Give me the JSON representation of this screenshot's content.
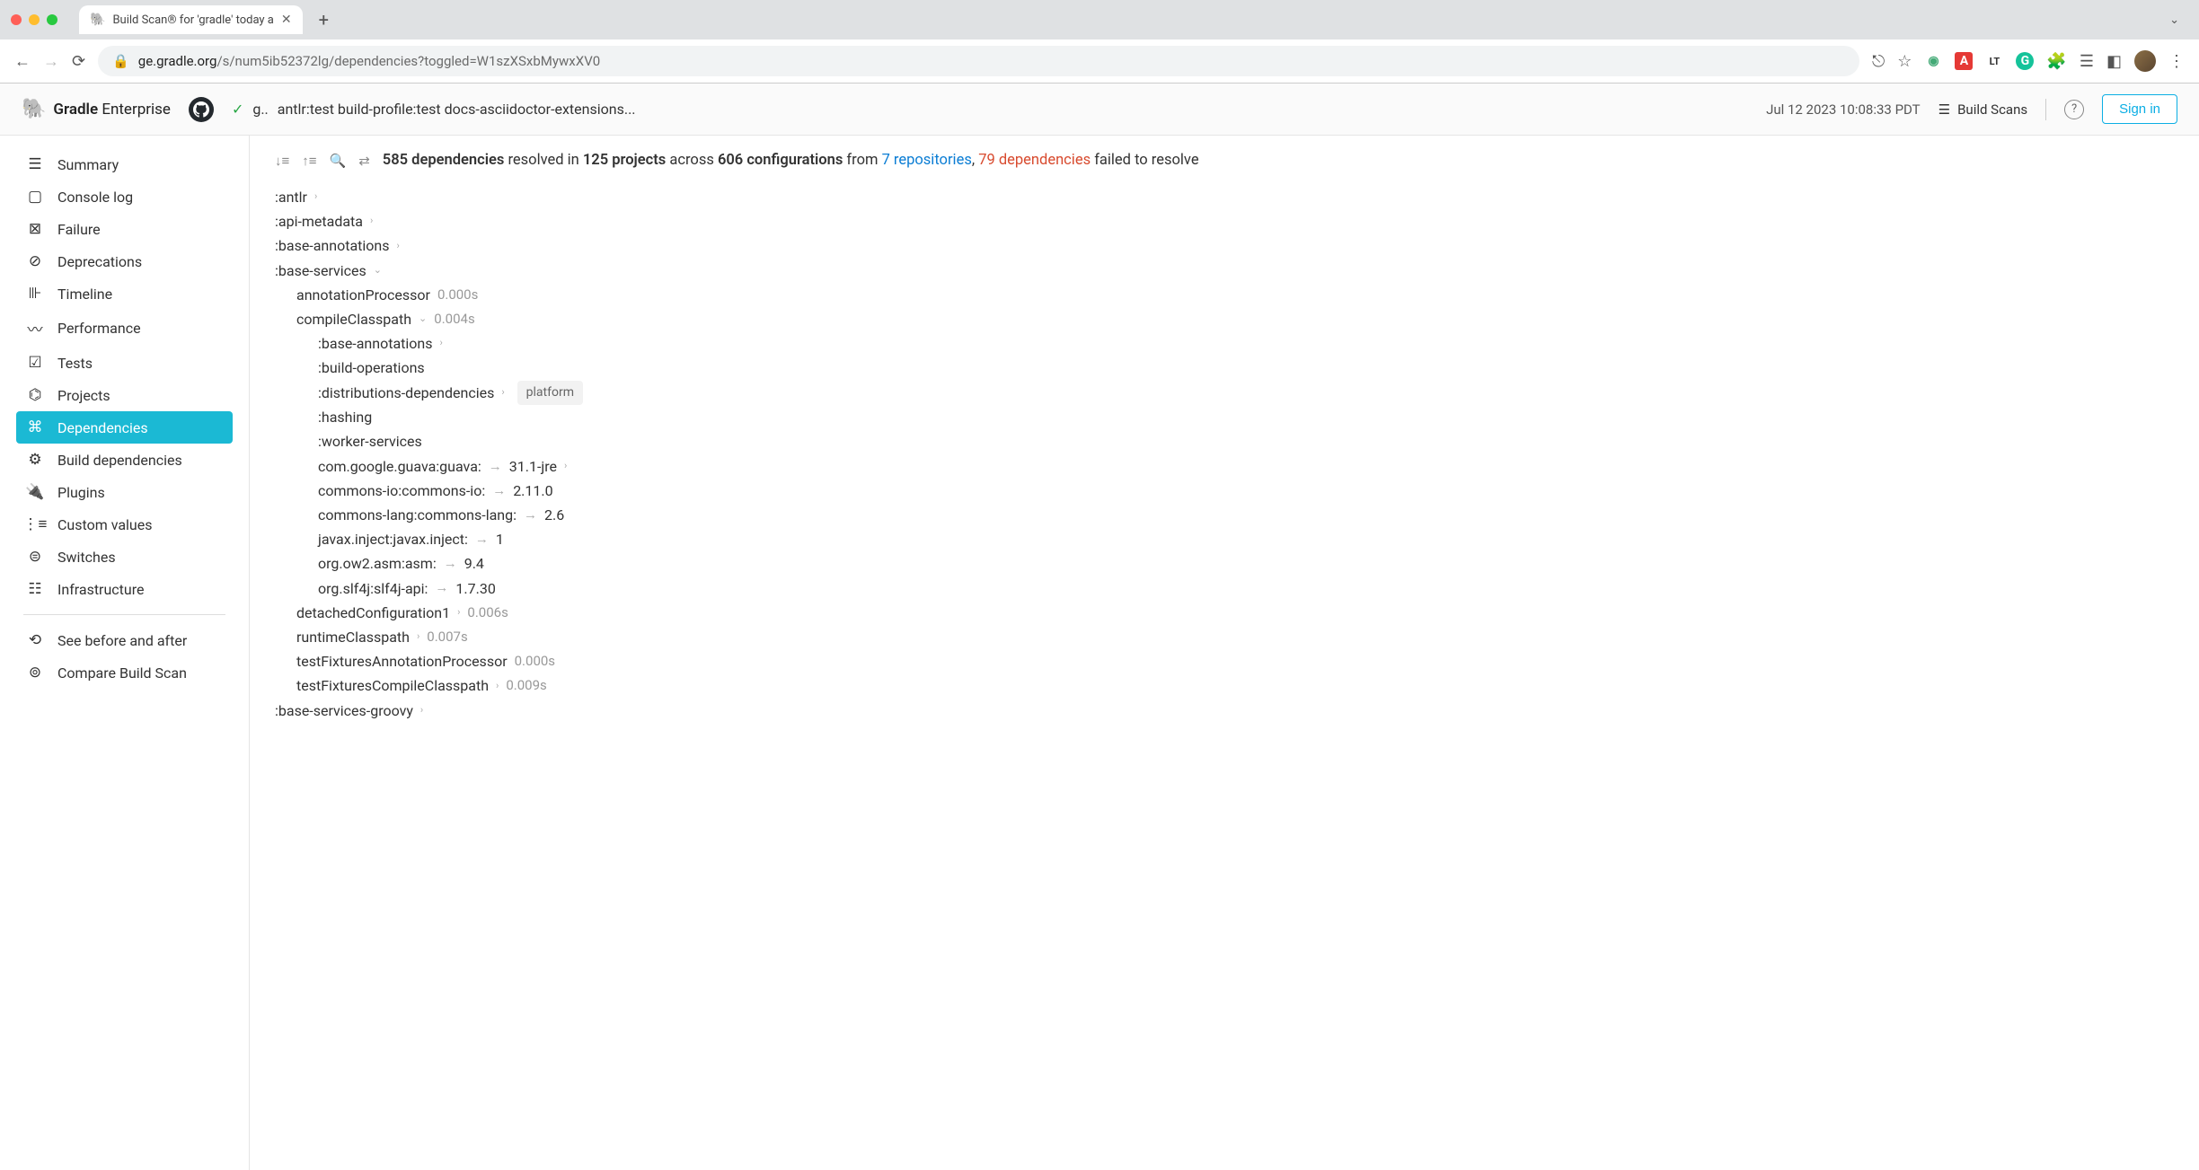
{
  "browser": {
    "tab_title": "Build Scan® for 'gradle' today a",
    "url_host": "ge.gradle.org",
    "url_path": "/s/num5ib52372lg/dependencies?toggled=W1szXSxbMywxXV0"
  },
  "header": {
    "logo_bold": "Gradle",
    "logo_light": "Enterprise",
    "proj_prefix": "g..",
    "build_title": "antlr:test build-profile:test docs-asciidoctor-extensions...",
    "build_date": "Jul 12 2023 10:08:33 PDT",
    "build_scans": "Build Scans",
    "sign_in": "Sign in"
  },
  "sidebar": {
    "items": [
      "Summary",
      "Console log",
      "Failure",
      "Deprecations",
      "Timeline",
      "Performance",
      "Tests",
      "Projects",
      "Dependencies",
      "Build dependencies",
      "Plugins",
      "Custom values",
      "Switches",
      "Infrastructure"
    ],
    "footer": [
      "See before and after",
      "Compare Build Scan"
    ]
  },
  "summary": {
    "deps_count": "585 dependencies",
    "resolved_in": "resolved in",
    "projects_count": "125 projects",
    "across": "across",
    "configs_count": "606 configurations",
    "from": "from",
    "repos_count": "7 repositories",
    "comma": ",",
    "failed_count": "79 dependencies",
    "failed_tail": "failed to resolve"
  },
  "tree": {
    "top": [
      ":antlr",
      ":api-metadata",
      ":base-annotations"
    ],
    "base_services": ":base-services",
    "ann_proc": {
      "label": "annotationProcessor",
      "time": "0.000s"
    },
    "compile_cp": {
      "label": "compileClasspath",
      "time": "0.004s"
    },
    "cp_children": [
      {
        "label": ":base-annotations",
        "chev": true
      },
      {
        "label": ":build-operations"
      },
      {
        "label": ":distributions-dependencies",
        "chev": true,
        "badge": "platform"
      },
      {
        "label": ":hashing"
      },
      {
        "label": ":worker-services"
      },
      {
        "label": "com.google.guava:guava:",
        "ver": "31.1-jre",
        "arrow": true,
        "chev": true
      },
      {
        "label": "commons-io:commons-io:",
        "ver": "2.11.0",
        "arrow": true
      },
      {
        "label": "commons-lang:commons-lang:",
        "ver": "2.6",
        "arrow": true
      },
      {
        "label": "javax.inject:javax.inject:",
        "ver": "1",
        "arrow": true
      },
      {
        "label": "org.ow2.asm:asm:",
        "ver": "9.4",
        "arrow": true
      },
      {
        "label": "org.slf4j:slf4j-api:",
        "ver": "1.7.30",
        "arrow": true
      }
    ],
    "more_configs": [
      {
        "label": "detachedConfiguration1",
        "time": "0.006s",
        "chev": true
      },
      {
        "label": "runtimeClasspath",
        "time": "0.007s",
        "chev": true
      },
      {
        "label": "testFixturesAnnotationProcessor",
        "time": "0.000s"
      },
      {
        "label": "testFixturesCompileClasspath",
        "time": "0.009s",
        "chev": true
      }
    ],
    "bottom": ":base-services-groovy"
  }
}
